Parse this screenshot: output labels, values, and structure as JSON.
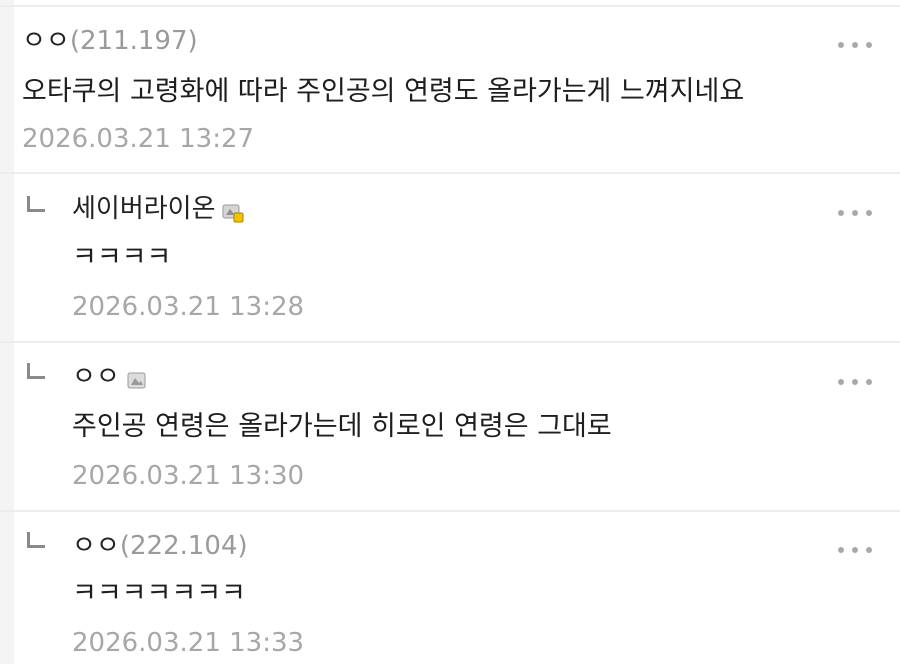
{
  "comments": [
    {
      "author": "ㅇㅇ",
      "ip": "(211.197)",
      "body": "오타쿠의 고령화에 따라 주인공의 연령도 올라가는게 느껴지네요",
      "time": "2026.03.21 13:27",
      "is_reply": false,
      "badge_icon": "none"
    },
    {
      "author": "세이버라이온",
      "ip": "",
      "body": "ㅋㅋㅋㅋ",
      "time": "2026.03.21 13:28",
      "is_reply": true,
      "badge_icon": "fixed-nick-badge-icon"
    },
    {
      "author": "ㅇㅇ",
      "ip": "",
      "body": "주인공 연령은 올라가는데 히로인 연령은 그대로",
      "time": "2026.03.21 13:30",
      "is_reply": true,
      "badge_icon": "half-fixed-nick-badge-icon"
    },
    {
      "author": "ㅇㅇ",
      "ip": "(222.104)",
      "body": "ㅋㅋㅋㅋㅋㅋㅋ",
      "time": "2026.03.21 13:33",
      "is_reply": true,
      "badge_icon": "none"
    }
  ],
  "colors": {
    "text": "#1e1e1e",
    "muted": "#a7a7a7",
    "divider": "#ededed",
    "sidebar_strip": "#f4f4f4"
  }
}
